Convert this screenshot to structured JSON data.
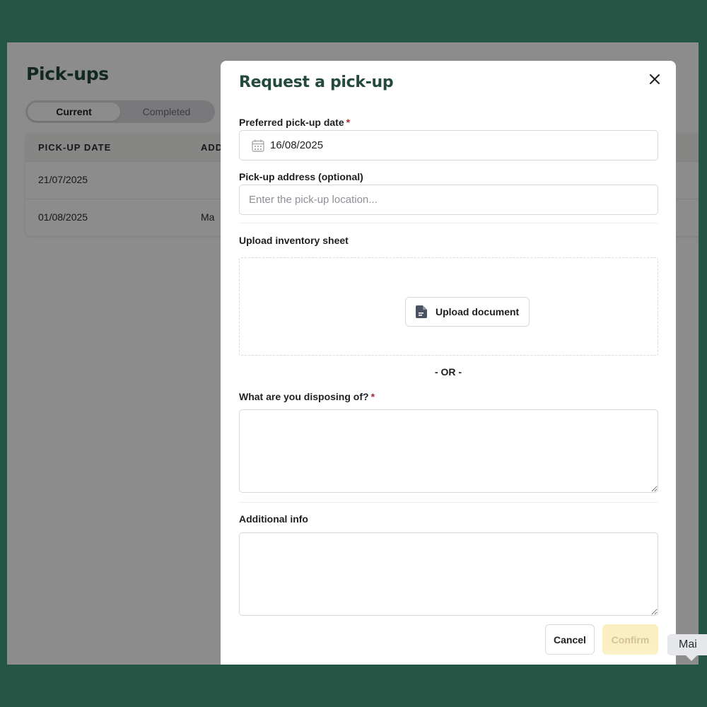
{
  "page": {
    "title": "Pick-ups",
    "tabs": [
      {
        "label": "Current",
        "active": true
      },
      {
        "label": "Completed",
        "active": false
      }
    ],
    "table": {
      "headers": [
        "PICK-UP DATE",
        "ADD"
      ],
      "rows": [
        {
          "date": "21/07/2025",
          "address": ""
        },
        {
          "date": "01/08/2025",
          "address": "Ma"
        }
      ]
    }
  },
  "modal": {
    "title": "Request a pick-up",
    "date_label": "Preferred pick-up date",
    "required_mark": "*",
    "date_value": "16/08/2025",
    "address_label": "Pick-up address (optional)",
    "address_placeholder": "Enter the pick-up location...",
    "address_value": "",
    "upload_label": "Upload inventory sheet",
    "upload_button": "Upload document",
    "or_text": "- OR -",
    "disposing_label": "What are you disposing of?",
    "disposing_value": "",
    "additional_label": "Additional info",
    "additional_value": "",
    "cancel_label": "Cancel",
    "confirm_label": "Confirm",
    "confirm_enabled": false
  },
  "tooltip": {
    "text": "Mai"
  },
  "colors": {
    "frame_bg": "#255645",
    "brand_green": "#234a3c",
    "required": "#b1272f",
    "confirm_disabled_bg": "#fbefc2"
  },
  "icons": {
    "close": "close-icon",
    "calendar": "calendar-icon",
    "document": "document-icon"
  }
}
